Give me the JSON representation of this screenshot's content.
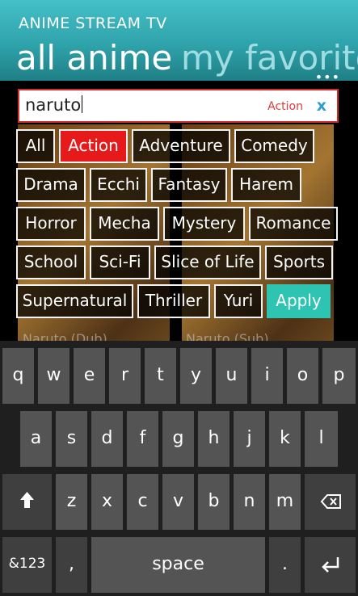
{
  "app_title": "ANIME STREAM TV",
  "pivots": {
    "active": "all anime",
    "next": "my favorite"
  },
  "more_label": "•••",
  "search": {
    "value": "naruto",
    "filter_tag": "Action",
    "clear_label": "x"
  },
  "genres": {
    "all": "All",
    "action": "Action",
    "adventure": "Adventure",
    "comedy": "Comedy",
    "drama": "Drama",
    "ecchi": "Ecchi",
    "fantasy": "Fantasy",
    "harem": "Harem",
    "horror": "Horror",
    "mecha": "Mecha",
    "mystery": "Mystery",
    "romance": "Romance",
    "school": "School",
    "scifi": "Sci-Fi",
    "slice_of_life": "Slice of Life",
    "sports": "Sports",
    "supernatural": "Supernatural",
    "thriller": "Thriller",
    "yuri": "Yuri",
    "selected": "Action"
  },
  "apply_label": "Apply",
  "results": {
    "item1": "Naruto (Dub)",
    "item2": "Naruto (Sub)"
  },
  "keyboard": {
    "row1": [
      "q",
      "w",
      "e",
      "r",
      "t",
      "y",
      "u",
      "i",
      "o",
      "p"
    ],
    "row2": [
      "a",
      "s",
      "d",
      "f",
      "g",
      "h",
      "j",
      "k",
      "l"
    ],
    "row3": [
      "z",
      "x",
      "c",
      "v",
      "b",
      "n",
      "m"
    ],
    "numbers_label": "&123",
    "comma": ",",
    "space_label": "space",
    "period": ".",
    "icons": {
      "shift": "shift-arrow",
      "backspace": "backspace",
      "enter": "enter-arrow"
    }
  },
  "colors": {
    "header_teal": "#3bb6be",
    "selected_red": "#e61a1a",
    "apply_teal": "#2ec4b2",
    "search_border": "#d32c2c",
    "clear_blue": "#2a9ed5"
  }
}
